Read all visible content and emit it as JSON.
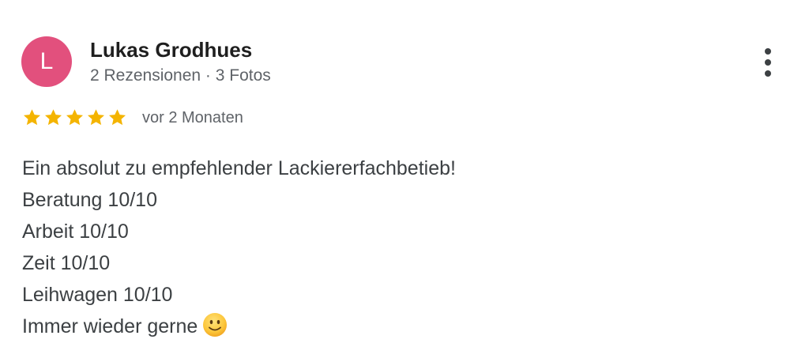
{
  "reviewer": {
    "avatar_letter": "L",
    "avatar_color": "#e2507d",
    "name": "Lukas Grodhues",
    "meta": "2 Rezensionen · 3 Fotos"
  },
  "menu": {
    "icon": "more-vert-icon"
  },
  "rating": {
    "stars": 5,
    "max_stars": 5,
    "star_color": "#f4b400",
    "date": "vor 2 Monaten"
  },
  "review": {
    "lines": [
      "Ein absolut zu empfehlender Lackiererfachbetieb!",
      "Beratung 10/10",
      "Arbeit 10/10",
      "Zeit 10/10",
      "Leihwagen 10/10",
      "Immer wieder gerne"
    ],
    "emoji": "slightly-smiling-face-icon"
  }
}
